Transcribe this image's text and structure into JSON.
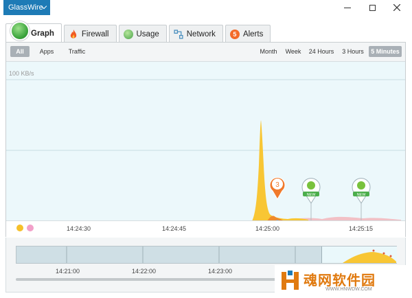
{
  "app": {
    "title": "GlassWire"
  },
  "tabs": [
    {
      "label": "Graph"
    },
    {
      "label": "Firewall"
    },
    {
      "label": "Usage"
    },
    {
      "label": "Network"
    },
    {
      "label": "Alerts",
      "badge": "5"
    }
  ],
  "filters": {
    "all": "All",
    "apps": "Apps",
    "traffic": "Traffic"
  },
  "ranges": {
    "month": "Month",
    "week": "Week",
    "h24": "24 Hours",
    "h3": "3 Hours",
    "m5": "5 Minutes"
  },
  "chart": {
    "ylabel": "100 KB/s",
    "ticks": [
      "14:24:30",
      "14:24:45",
      "14:25:00",
      "14:25:15"
    ],
    "markers": [
      {
        "kind": "alert",
        "text": "3",
        "color": "#f07a2c"
      },
      {
        "kind": "new",
        "text": "NEW",
        "color": "#4cae4c"
      },
      {
        "kind": "new",
        "text": "NEW",
        "color": "#4cae4c"
      }
    ]
  },
  "overview": {
    "ticks": [
      "14:21:00",
      "14:22:00",
      "14:23:00"
    ]
  },
  "watermark": {
    "title": "魂网软件园",
    "url": "WWW.HNWDW.COM"
  }
}
